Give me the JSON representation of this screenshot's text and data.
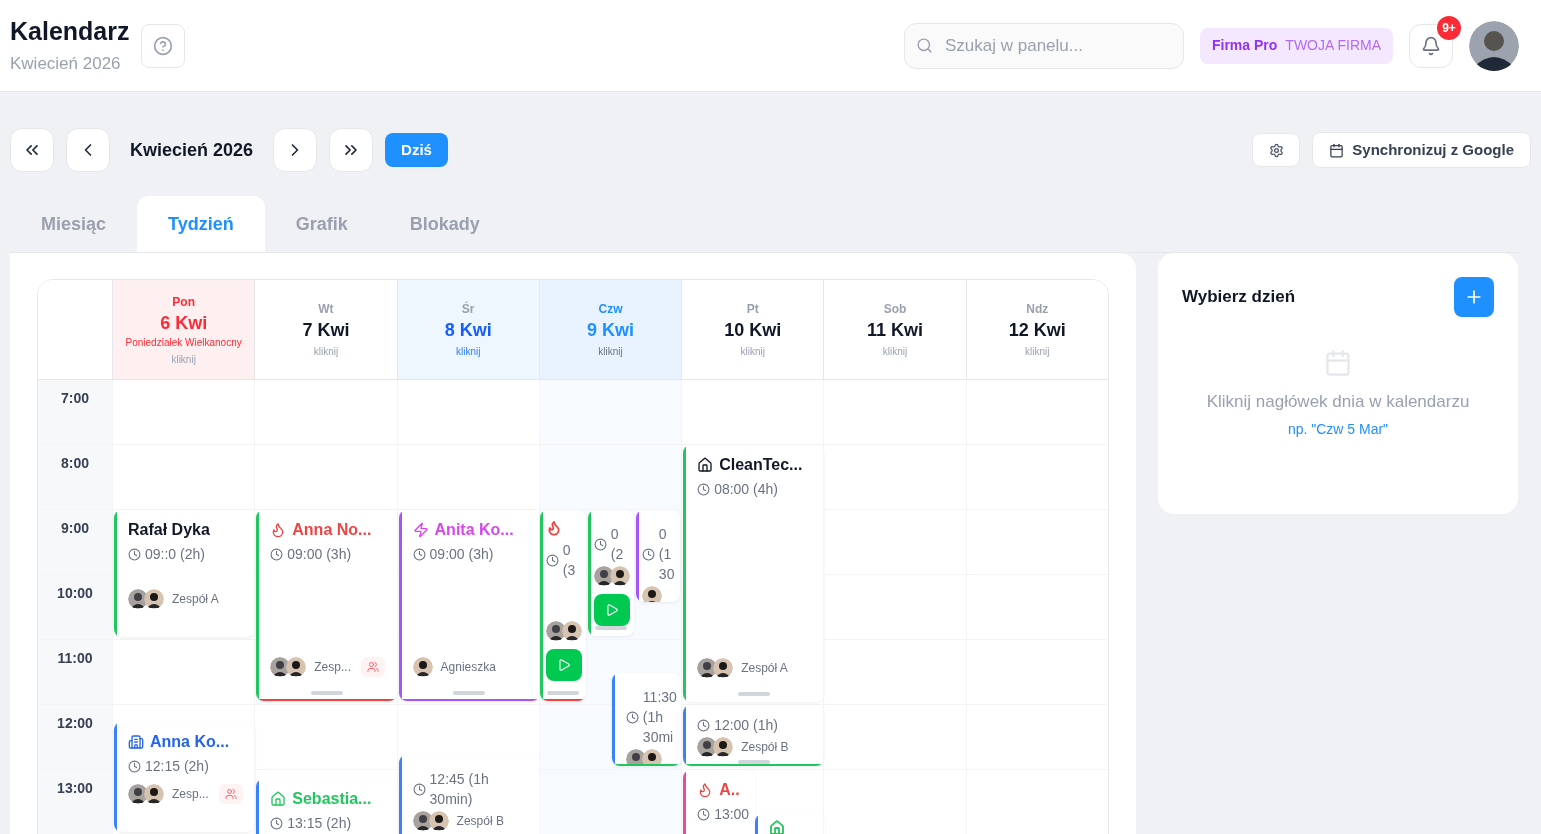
{
  "header": {
    "title": "Kalendarz",
    "subtitle": "Kwiecień 2026",
    "search": {
      "placeholder": "Szukaj w panelu..."
    },
    "plan": {
      "name": "Firma Pro",
      "company": "TWOJA FIRMA"
    },
    "notifications": "9+"
  },
  "toolbar": {
    "period": "Kwiecień 2026",
    "today": "Dziś",
    "sync": "Synchronizuj z Google"
  },
  "tabs": [
    {
      "label": "Miesiąc",
      "selected": false
    },
    {
      "label": "Tydzień",
      "selected": true
    },
    {
      "label": "Grafik",
      "selected": false
    },
    {
      "label": "Blokady",
      "selected": false
    }
  ],
  "hours": [
    "7:00",
    "8:00",
    "9:00",
    "10:00",
    "11:00",
    "12:00",
    "13:00"
  ],
  "days": [
    {
      "name": "Pon",
      "date": "6 Kwi",
      "kind": "holiday",
      "holiday": "Poniedziałek Wielkanocny",
      "hint": "kliknij",
      "events": [
        {
          "kind": "plain",
          "title": "Rafał Dyka",
          "color": "#111827",
          "time": "09::0 (2h)",
          "people": [
            {
              "kind": "man"
            },
            {
              "kind": "woman"
            }
          ],
          "team": "Zespół A",
          "bar": {
            "color": "#22c55e"
          },
          "team_badge": false,
          "play": false,
          "handle": false
        },
        {
          "kind": "building",
          "title": "Anna Ko...",
          "color": "#2563eb",
          "time": "12:15 (2h)",
          "people": [
            {
              "kind": "man"
            },
            {
              "kind": "woman"
            }
          ],
          "team": "Zesp...",
          "bar": {
            "color": "#3b82f6"
          },
          "team_badge": true
        }
      ]
    },
    {
      "name": "Wt",
      "date": "7 Kwi",
      "kind": "normal",
      "hint": "kliknij",
      "events": [
        {
          "kind": "flame",
          "title": "Anna No...",
          "color": "#ef4444",
          "time": "09:00 (3h)",
          "people": [
            {
              "kind": "man"
            },
            {
              "kind": "woman"
            }
          ],
          "team": "Zesp...",
          "bar": {
            "color": "#22c55e"
          },
          "underline": {
            "color": "#ef4444"
          },
          "team_badge": true,
          "play": false,
          "handle": true
        },
        {
          "kind": "home",
          "title": "Sebastia...",
          "color": "#22c55e",
          "time": "13:15 (2h)",
          "bar": {
            "color": "#3b82f6"
          }
        }
      ]
    },
    {
      "name": "Śr",
      "date": "8 Kwi",
      "kind": "hover",
      "hint": "kliknij",
      "events": [
        {
          "kind": "lightning",
          "title": "Anita Ko...",
          "color": "#d946ef",
          "time": "09:00 (3h)",
          "people": [
            {
              "kind": "woman"
            }
          ],
          "team": "Agnieszka",
          "bar": {
            "color": "#a855f7"
          },
          "underline": {
            "color": "#a855f7"
          },
          "team_badge": false,
          "play": false,
          "handle": true
        },
        {
          "kind": "plain",
          "time": "12:45 (1h 30min)",
          "people": [
            {
              "kind": "man"
            },
            {
              "kind": "woman"
            }
          ],
          "team": "Zespół B",
          "bar": {
            "color": "#3b82f6"
          },
          "team_badge": false
        }
      ]
    },
    {
      "name": "Czw",
      "date": "9 Kwi",
      "kind": "today",
      "hint": "kliknij",
      "events": [
        {
          "kind": "flame",
          "color": "#ef4444",
          "time": "0 (3",
          "people": [
            {
              "kind": "man"
            },
            {
              "kind": "woman"
            }
          ],
          "bar": {
            "color": "#22c55e"
          },
          "underline": {
            "color": "#ef4444"
          },
          "play": true,
          "handle": true
        },
        {
          "kind": "plain",
          "time": "0 (2",
          "people": [
            {
              "kind": "man"
            },
            {
              "kind": "woman"
            }
          ],
          "bar": {
            "color": "#22c55e"
          },
          "play": true,
          "handle": true
        },
        {
          "kind": "plain",
          "time": "0 (1 30",
          "people": [
            {
              "kind": "woman"
            }
          ],
          "bar": {
            "color": "#a855f7"
          },
          "handle": false
        },
        {
          "kind": "plain",
          "time": "11:30 (1h 30mi",
          "people": [
            {
              "kind": "man"
            },
            {
              "kind": "woman"
            }
          ],
          "bar": {
            "color": "#3b82f6"
          },
          "underline": {
            "color": "#22c55e"
          },
          "handle": false
        }
      ]
    },
    {
      "name": "Pt",
      "date": "10 Kwi",
      "kind": "normal",
      "hint": "kliknij",
      "events": [
        {
          "kind": "home",
          "title": "CleanTec...",
          "color": "#111827",
          "time": "08:00 (4h)",
          "people": [
            {
              "kind": "man"
            },
            {
              "kind": "woman"
            }
          ],
          "team": "Zespół A",
          "bar": {
            "color": "#22c55e"
          },
          "team_badge": false,
          "play": false,
          "handle": true
        },
        {
          "kind": "plain",
          "time": "12:00 (1h)",
          "people": [
            {
              "kind": "man"
            },
            {
              "kind": "woman"
            }
          ],
          "team": "Zespół B",
          "bar": {
            "color": "#3b82f6"
          },
          "underline": {
            "color": "#22c55e"
          },
          "team_badge": false,
          "handle": true
        },
        {
          "kind": "flame",
          "title": "A..",
          "color": "#ef4444",
          "time": "13:00",
          "bar": {
            "color": "#ec4899"
          }
        },
        {
          "kind": "home",
          "color": "#22c55e",
          "bar": {
            "color": "#3b82f6"
          }
        }
      ]
    },
    {
      "name": "Sob",
      "date": "11 Kwi",
      "kind": "normal",
      "hint": "kliknij"
    },
    {
      "name": "Ndz",
      "date": "12 Kwi",
      "kind": "normal",
      "hint": "kliknij"
    }
  ],
  "day_panel": {
    "title": "Wybierz dzień",
    "message": "Kliknij nagłówek dnia w kalendarzu",
    "example": "np. \"Czw 5 Mar\""
  }
}
